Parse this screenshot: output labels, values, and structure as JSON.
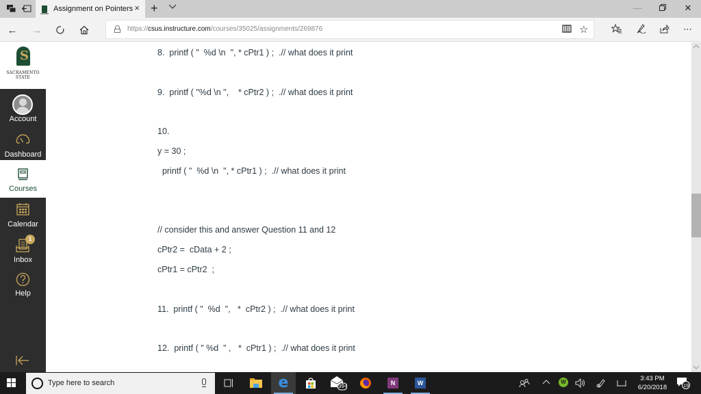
{
  "browser": {
    "tab_title": "Assignment on Pointers",
    "tab_close": "×",
    "new_tab": "+",
    "tab_menu": "⌵",
    "url_scheme": "https://",
    "url_host": "csus.instructure.com",
    "url_path": "/courses/35025/assignments/269876",
    "window_controls": {
      "minimize": "—",
      "maximize": "❐",
      "close": "✕"
    },
    "icons": {
      "back": "←",
      "forward": "→",
      "refresh": "↻",
      "home": "⌂",
      "reading_view": "📖",
      "favorite": "☆",
      "favorites_hub": "☆≡",
      "notes": "✎",
      "share": "⇗",
      "more": "⋯"
    }
  },
  "sidebar": {
    "logo_line1": "SACRAMENTO",
    "logo_line2": "STATE",
    "logo_glyph": "S",
    "items": [
      {
        "label": "Account",
        "active": false
      },
      {
        "label": "Dashboard",
        "active": false
      },
      {
        "label": "Courses",
        "active": true
      },
      {
        "label": "Calendar",
        "active": false
      },
      {
        "label": "Inbox",
        "active": false,
        "badge": "1"
      },
      {
        "label": "Help",
        "active": false
      }
    ],
    "collapse_icon": "|←"
  },
  "content": {
    "lines": [
      "8.  printf ( \"  %d \\n  \", * cPtr1 ) ;  .// what does it print",
      "9.  printf ( \"%d \\n \",    * cPtr2 ) ;  .// what does it print",
      "10.",
      "y = 30 ;",
      "  printf ( \"  %d \\n  \", * cPtr1 ) ;  .// what does it print",
      "// consider this and answer Question 11 and 12",
      "cPtr2 =  cData + 2 ;",
      "cPtr1 = cPtr2  ;",
      "11.  printf ( \"  %d  \",   *  cPtr2 ) ;  .// what does it print",
      "12.  printf ( \" %d  \" ,   *  cPtr1 ) ;  .// what does it print"
    ]
  },
  "taskbar": {
    "search_placeholder": "Type here to search",
    "mail_badge": "99+",
    "onenote_label": "N",
    "word_label": "W",
    "tray_badge": "W",
    "time": "3:43 PM",
    "date": "6/20/2018",
    "notification_count": "19"
  },
  "colors": {
    "brand_green": "#1d4d33",
    "brand_gold": "#c9a85c",
    "sidebar_bg": "#2d2d2d",
    "text": "#2d3b45"
  }
}
